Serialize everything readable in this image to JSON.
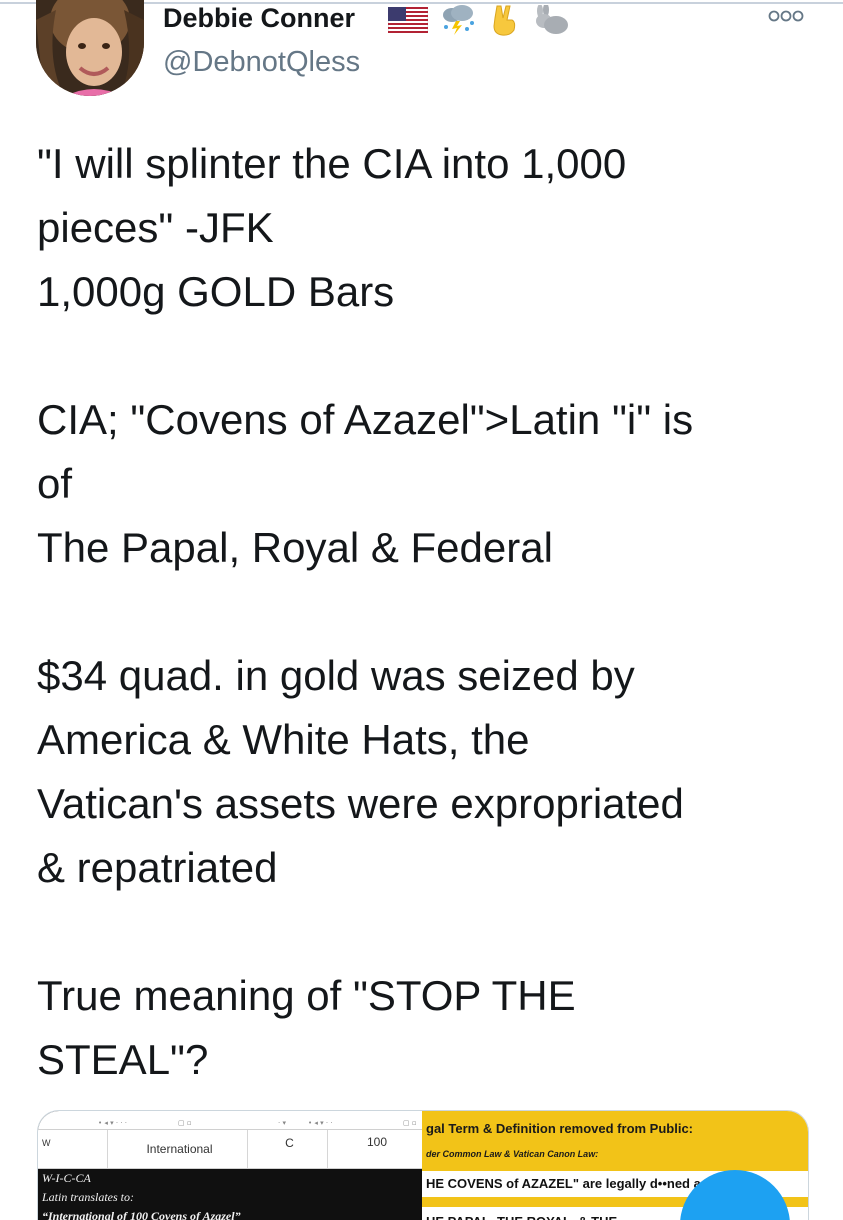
{
  "tweet": {
    "author": {
      "display_name": "Debbie Conner",
      "handle": "@DebnotQless",
      "name_emojis": [
        "us-flag-icon",
        "storm-cloud-icon",
        "victory-hand-icon",
        "rabbit-icon"
      ]
    },
    "more_menu_icon": "more-options-icon",
    "body_paragraphs": [
      [
        "\"I will splinter the CIA into 1,000",
        "pieces\" -JFK",
        "1,000g GOLD Bars"
      ],
      [
        "CIA; \"Covens of Azazel\">Latin \"i\" is",
        "of",
        "The Papal, Royal & Federal"
      ],
      [
        "$34 quad. in gold was seized by",
        "America & White Hats, the",
        "Vatican's assets were expropriated",
        "& repatriated"
      ],
      [
        "True meaning of \"STOP THE",
        "STEAL\"?"
      ]
    ],
    "media": {
      "left_panel": {
        "sheet_cells": [
          "W",
          "International",
          "C",
          "100"
        ],
        "lines": [
          "W-I-C-CA",
          "Latin translates to:",
          "“International of 100 Covens of Azazel”"
        ]
      },
      "right_panel": {
        "title": "gal Term & Definition removed from Public:",
        "subtitle": "der Common Law & Vatican Canon Law:",
        "line1": "HE COVENS of AZAZEL\" are legally d••ned as:",
        "line2": "HE PAPAL, THE ROYAL, & THE"
      }
    }
  },
  "colors": {
    "text_primary": "#14171a",
    "text_secondary": "#657786",
    "twitter_blue": "#1da1f2",
    "gold_panel": "#f2c318"
  }
}
